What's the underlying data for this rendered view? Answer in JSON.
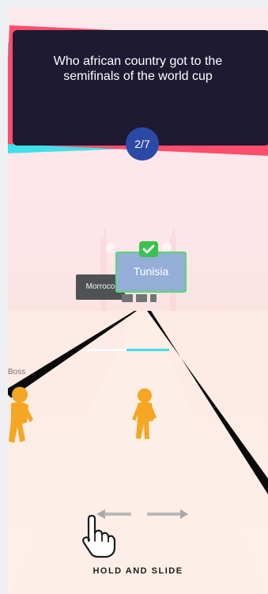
{
  "question": {
    "text": "Who african country got to the semifinals of the world cup",
    "progress": "2/7"
  },
  "answers": {
    "left": "Morroco",
    "right": "Tunisia",
    "correct": "right"
  },
  "opponent_label": "Boss",
  "instruction": "HOLD AND SLIDE",
  "colors": {
    "card": "#1e1a32",
    "stripe_cyan": "#3ee0ea",
    "stripe_red": "#ff4d6d",
    "progress_badge": "#2b4aa6",
    "runner": "#f5a623",
    "correct_border": "#5cd86d",
    "track_marker": "#3ee0ea"
  },
  "icons": [
    "checkmark-icon",
    "hand-pointer-icon",
    "left-right-arrow-icon"
  ]
}
